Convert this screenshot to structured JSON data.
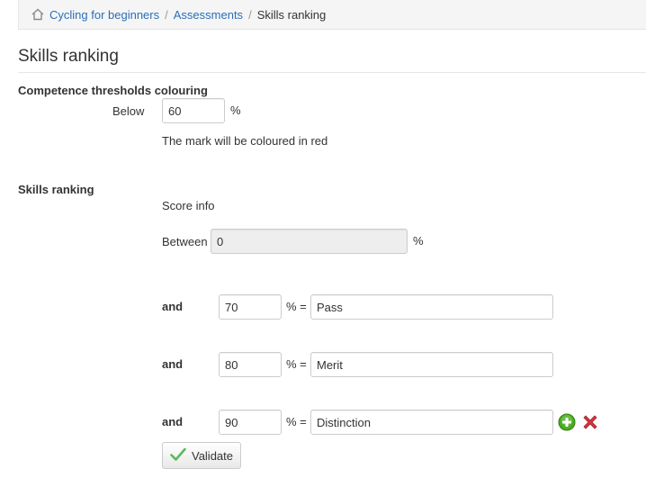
{
  "breadcrumb": {
    "items": [
      {
        "label": "Cycling for beginners"
      },
      {
        "label": "Assessments"
      }
    ],
    "separator": "/",
    "current": "Skills ranking"
  },
  "page": {
    "title": "Skills ranking"
  },
  "thresholds": {
    "heading": "Competence thresholds colouring",
    "below_label": "Below",
    "below_value": "60",
    "percent": "%",
    "help_text": "The mark will be coloured in red"
  },
  "ranking": {
    "heading": "Skills ranking",
    "score_info": "Score info",
    "between_label": "Between",
    "between_value": "0",
    "percent": "%",
    "equals": "% =",
    "rows": [
      {
        "and_label": "and",
        "threshold": "70",
        "name": "Pass"
      },
      {
        "and_label": "and",
        "threshold": "80",
        "name": "Merit"
      },
      {
        "and_label": "and",
        "threshold": "90",
        "name": "Distinction"
      }
    ],
    "validate_label": "Validate"
  },
  "colors": {
    "link": "#2a6fb8",
    "add_green": "#4cae1f",
    "delete_red": "#d9363e",
    "check_green": "#5cb85c"
  },
  "icons": [
    "home-icon",
    "add-icon",
    "delete-icon",
    "check-icon"
  ]
}
